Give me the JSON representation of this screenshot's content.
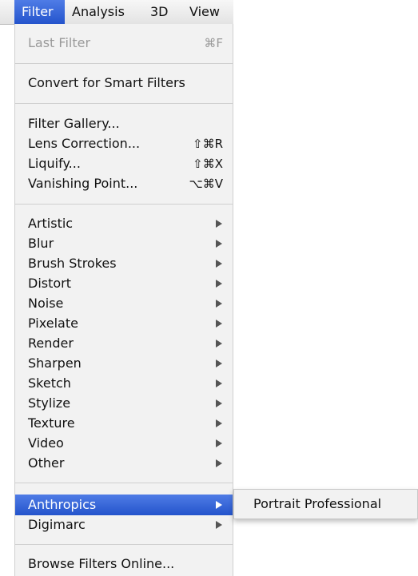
{
  "menubar": {
    "items": [
      {
        "label": "Filter",
        "active": true
      },
      {
        "label": "Analysis",
        "active": false
      },
      {
        "label": "3D",
        "active": false
      },
      {
        "label": "View",
        "active": false
      }
    ]
  },
  "filter_menu": {
    "last_filter": {
      "label": "Last Filter",
      "shortcut": "⌘F",
      "enabled": false
    },
    "convert_smart": {
      "label": "Convert for Smart Filters"
    },
    "filter_gallery": {
      "label": "Filter Gallery..."
    },
    "lens_correction": {
      "label": "Lens Correction...",
      "shortcut": "⇧⌘R"
    },
    "liquify": {
      "label": "Liquify...",
      "shortcut": "⇧⌘X"
    },
    "vanishing_point": {
      "label": "Vanishing Point...",
      "shortcut": "⌥⌘V"
    },
    "filter_groups": [
      "Artistic",
      "Blur",
      "Brush Strokes",
      "Distort",
      "Noise",
      "Pixelate",
      "Render",
      "Sharpen",
      "Sketch",
      "Stylize",
      "Texture",
      "Video",
      "Other"
    ],
    "plugins": [
      {
        "label": "Anthropics",
        "highlighted": true
      },
      {
        "label": "Digimarc",
        "highlighted": false
      }
    ],
    "browse_online": {
      "label": "Browse Filters Online..."
    }
  },
  "submenu": {
    "items": [
      "Portrait Professional"
    ]
  },
  "colors": {
    "highlight": "#2f5fd8",
    "menu_bg": "#f2f2f2",
    "disabled_text": "#9a9a9a"
  },
  "icons": {
    "submenu_arrow": "submenu-arrow-icon"
  }
}
